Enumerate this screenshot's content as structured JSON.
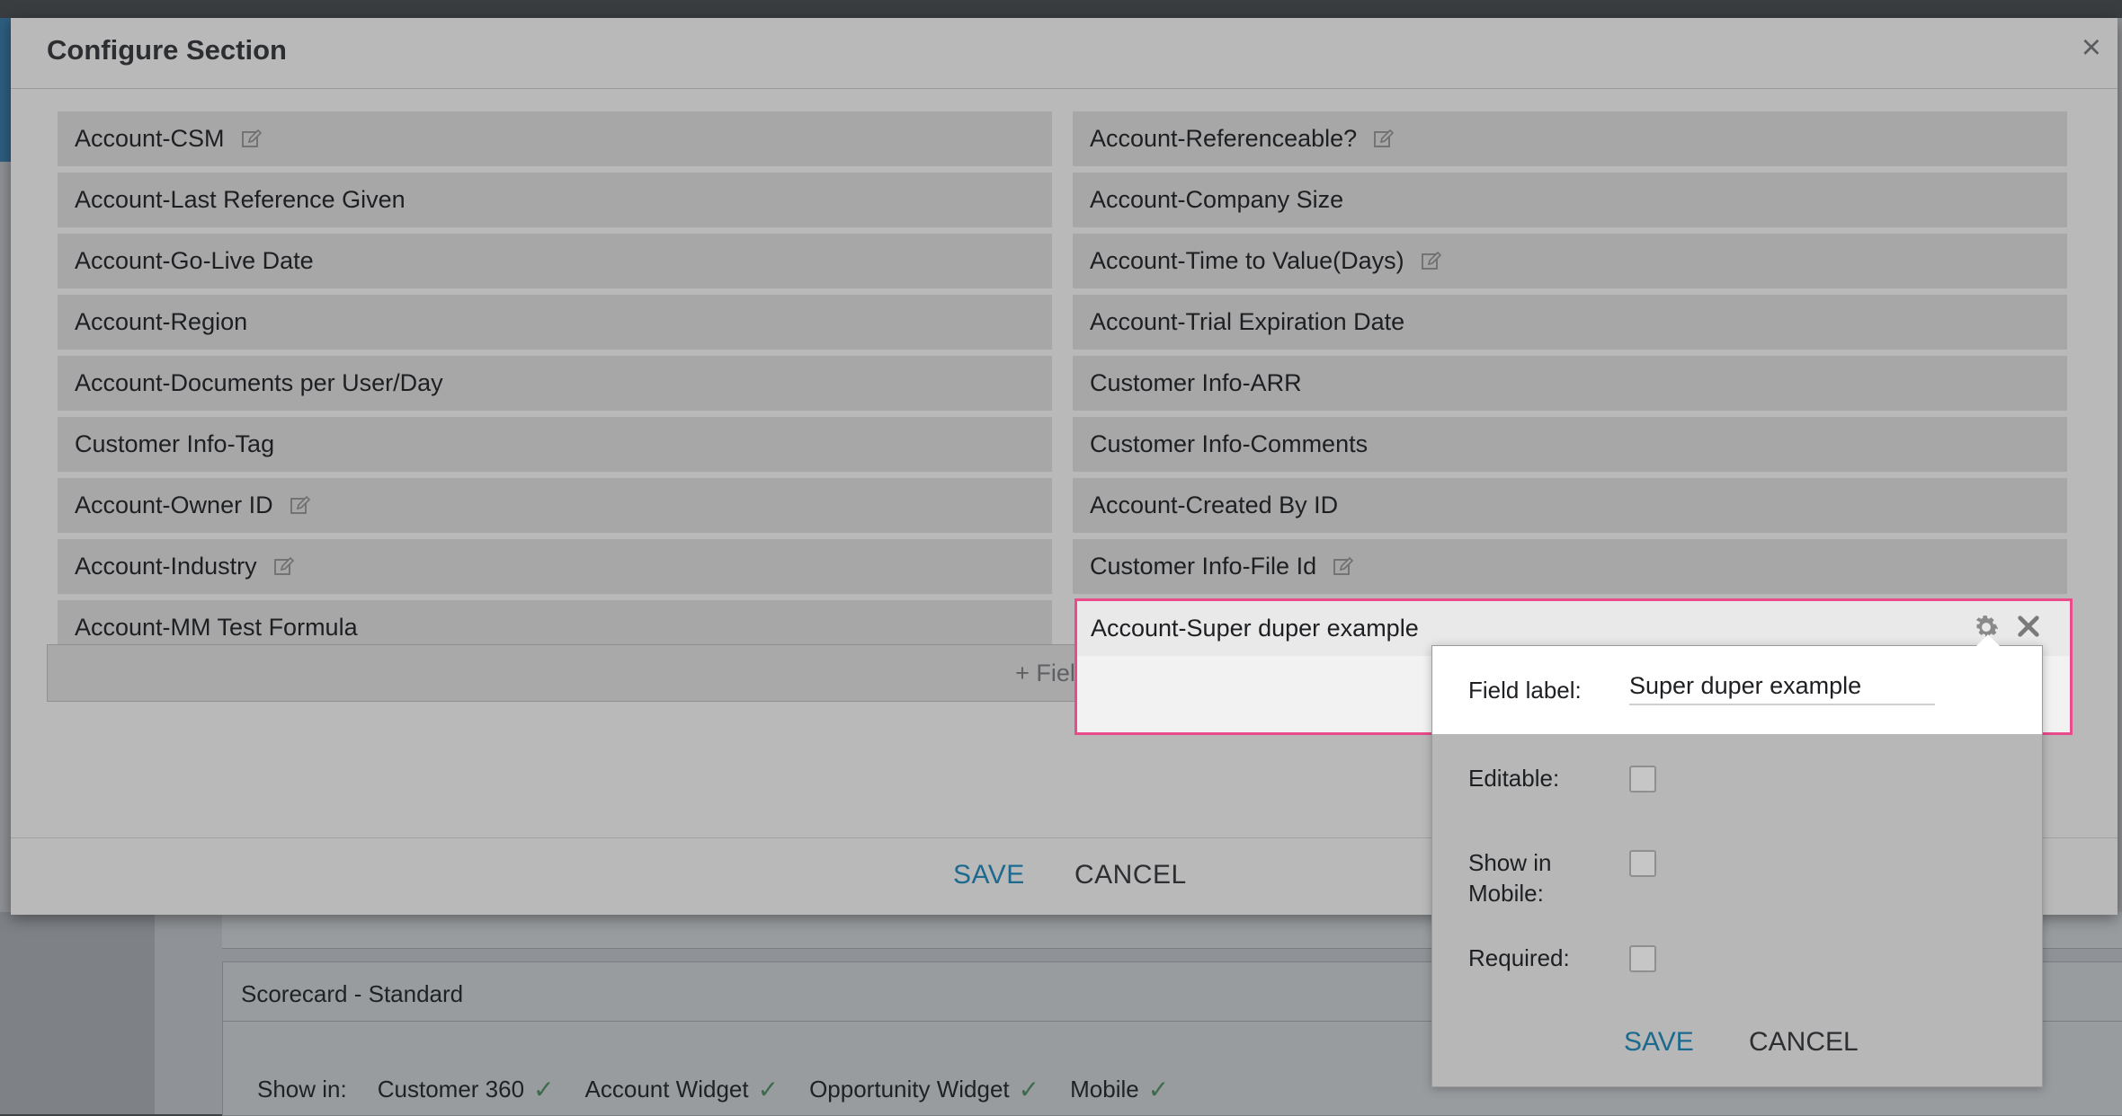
{
  "background": {
    "section_title": "Scorecard - Standard",
    "show_in_label": "Show in:",
    "show_in_options": [
      "Customer 360",
      "Account Widget",
      "Opportunity Widget",
      "Mobile"
    ]
  },
  "modal": {
    "title": "Configure Section",
    "close_symbol": "×",
    "left_fields": [
      {
        "label": "Account-CSM",
        "editable": true
      },
      {
        "label": "Account-Last Reference Given",
        "editable": false
      },
      {
        "label": "Account-Go-Live Date",
        "editable": false
      },
      {
        "label": "Account-Region",
        "editable": false
      },
      {
        "label": "Account-Documents per User/Day",
        "editable": false
      },
      {
        "label": "Customer Info-Tag",
        "editable": false
      },
      {
        "label": "Account-Owner ID",
        "editable": true
      },
      {
        "label": "Account-Industry",
        "editable": true
      },
      {
        "label": "Account-MM Test Formula",
        "editable": false
      }
    ],
    "right_fields": [
      {
        "label": "Account-Referenceable?",
        "editable": true
      },
      {
        "label": "Account-Company Size",
        "editable": false
      },
      {
        "label": "Account-Time to Value(Days)",
        "editable": true
      },
      {
        "label": "Account-Trial Expiration Date",
        "editable": false
      },
      {
        "label": "Customer Info-ARR",
        "editable": false
      },
      {
        "label": "Customer Info-Comments",
        "editable": false
      },
      {
        "label": "Account-Created By ID",
        "editable": false
      },
      {
        "label": "Customer Info-File Id",
        "editable": true
      }
    ],
    "active_field": {
      "label": "Account-Super duper example"
    },
    "add_field_label": "+ Field",
    "save_label": "SAVE",
    "cancel_label": "CANCEL"
  },
  "popover": {
    "field_label_label": "Field label:",
    "field_label_value": "Super duper example",
    "editable_label": "Editable:",
    "show_in_mobile_label": "Show in\nMobile:",
    "required_label": "Required:",
    "save_label": "SAVE",
    "cancel_label": "CANCEL"
  },
  "colors": {
    "accent": "#1d6a8f",
    "highlight": "#ea4b8b"
  }
}
